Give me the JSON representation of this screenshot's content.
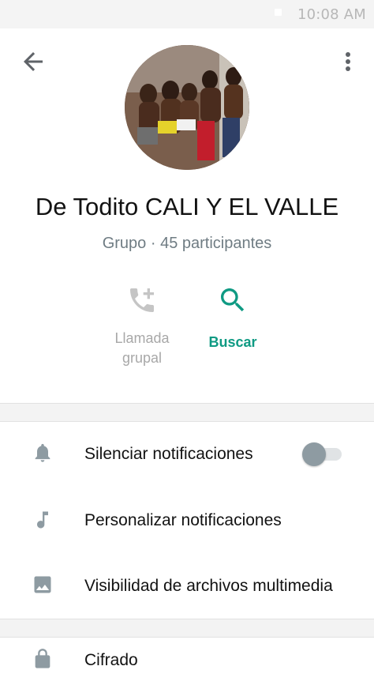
{
  "status_bar": {
    "time": "10:08 AM"
  },
  "header": {
    "back_icon": "arrow-left-icon",
    "menu_icon": "more-vert-icon"
  },
  "group": {
    "name": "De Todito CALI Y EL VALLE",
    "subtitle": "Grupo · 45 participantes"
  },
  "actions": {
    "group_call": {
      "label_line1": "Llamada",
      "label_line2": "grupal",
      "icon": "add-call-icon",
      "enabled": false
    },
    "search": {
      "label": "Buscar",
      "icon": "search-icon"
    }
  },
  "settings": {
    "mute": {
      "label": "Silenciar notificaciones",
      "icon": "bell-icon",
      "toggle_on": false
    },
    "custom_notifications": {
      "label": "Personalizar notificaciones",
      "icon": "music-note-icon"
    },
    "media_visibility": {
      "label": "Visibilidad de archivos multimedia",
      "icon": "image-icon"
    },
    "encryption": {
      "label": "Cifrado",
      "icon": "lock-icon"
    }
  },
  "colors": {
    "accent": "#0f9a83",
    "icon_gray": "#8e9ba2",
    "disabled": "#a8a8a8",
    "subtitle": "#6f7c83"
  }
}
